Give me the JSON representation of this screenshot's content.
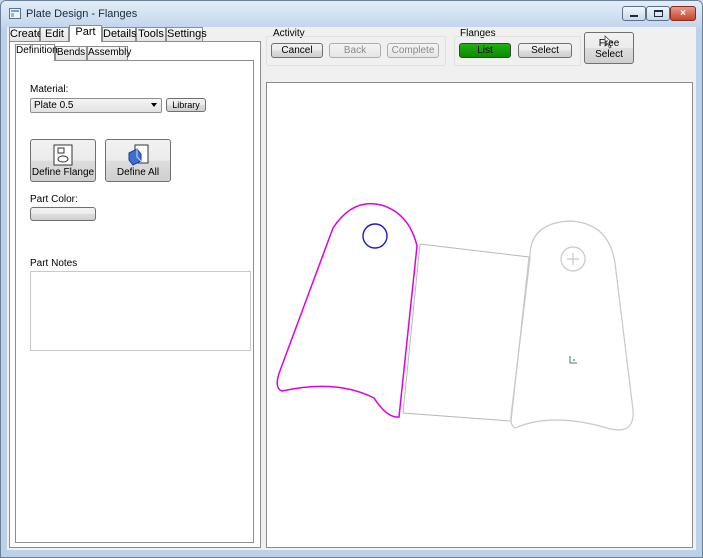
{
  "window": {
    "title": "Plate Design - Flanges",
    "close_glyph": "×"
  },
  "main_tabs": [
    "Create",
    "Edit",
    "Part",
    "Details",
    "Tools",
    "Settings"
  ],
  "sub_tabs": [
    "Definition",
    "Bends",
    "Assembly"
  ],
  "definition": {
    "material_label": "Material:",
    "material_value": "Plate 0.5",
    "library_button": "Library",
    "define_flange_button": "Define Flange",
    "define_all_button": "Define All",
    "part_color_label": "Part Color:",
    "part_notes_label": "Part Notes"
  },
  "activity": {
    "title": "Activity",
    "cancel": "Cancel",
    "back": "Back",
    "complete": "Complete"
  },
  "flanges": {
    "title": "Flanges",
    "list": "List",
    "select": "Select",
    "list_color": "#0a8a00"
  },
  "free_select": "Free Select",
  "colors": {
    "selected_outline": "#e000e0",
    "hole": "#1a1acc",
    "unselected_outline": "#c8c8c8",
    "bend_outline": "#b8b8b8"
  }
}
